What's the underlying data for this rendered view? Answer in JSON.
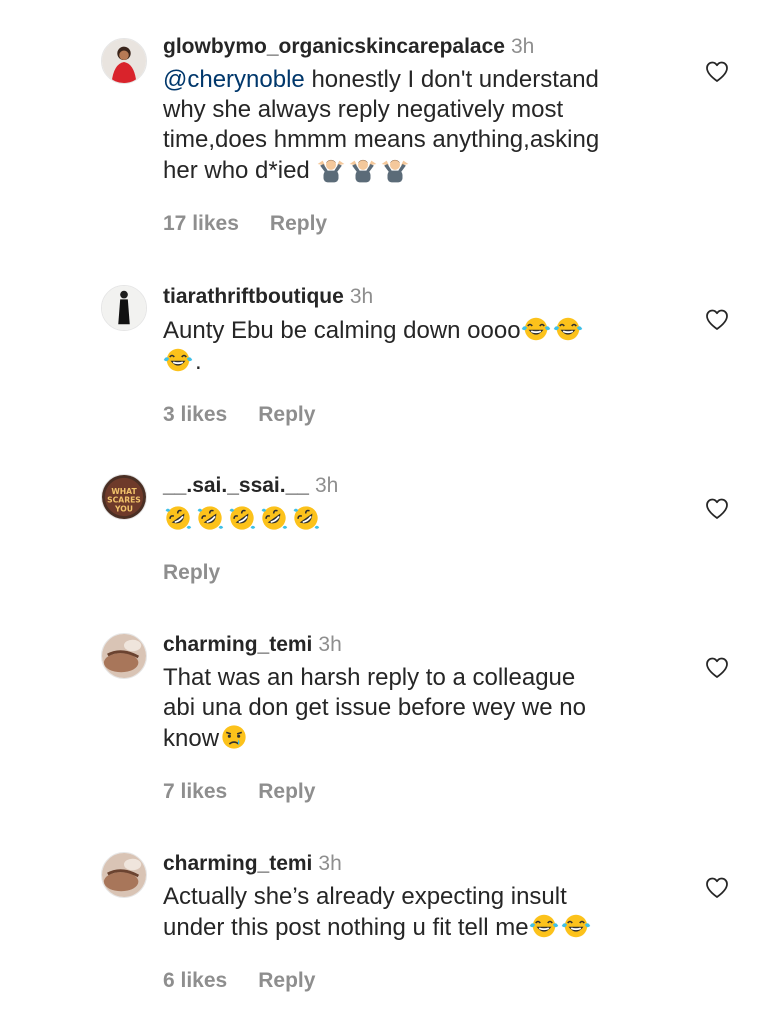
{
  "comments": [
    {
      "username": "glowbymo_organicskincarepalace",
      "time": "3h",
      "mention": "@cherynoble",
      "text": " honestly I don't understand\nwhy she always reply negatively most\ntime,does hmmm means anything,asking\nher who d*ied ",
      "emojis": [
        "shrug",
        "shrug",
        "shrug"
      ],
      "likes": "17 likes",
      "reply": "Reply"
    },
    {
      "username": "tiarathriftboutique",
      "time": "3h",
      "text_before": "Aunty Ebu be calming down oooo",
      "text_after": ".",
      "emojis": [
        "tears-of-joy",
        "tears-of-joy",
        "tears-of-joy"
      ],
      "likes": "3 likes",
      "reply": "Reply"
    },
    {
      "username": "__.sai._ssai.__",
      "time": "3h",
      "emojis": [
        "rofl",
        "rofl",
        "rofl",
        "rofl",
        "rofl"
      ],
      "reply": "Reply"
    },
    {
      "username": "charming_temi",
      "time": "3h",
      "text": "That was an harsh reply to a colleague\nabi una don get issue before wey we no\nknow",
      "emojis": [
        "crying"
      ],
      "likes": "7 likes",
      "reply": "Reply"
    },
    {
      "username": "charming_temi",
      "time": "3h",
      "text": "Actually she’s already expecting insult\nunder this post nothing u fit tell me",
      "emojis": [
        "tears-of-joy",
        "tears-of-joy"
      ],
      "likes": "6 likes",
      "reply": "Reply"
    }
  ],
  "icons": {
    "heart": "heart-outline-icon",
    "shrug": "person-shrugging-emoji",
    "tears_of_joy": "face-with-tears-of-joy-emoji",
    "rofl": "rolling-on-floor-laughing-emoji",
    "crying": "crying-face-emoji"
  },
  "colors": {
    "text": "#262626",
    "secondary": "#8e8e8e",
    "mention": "#00376b"
  }
}
